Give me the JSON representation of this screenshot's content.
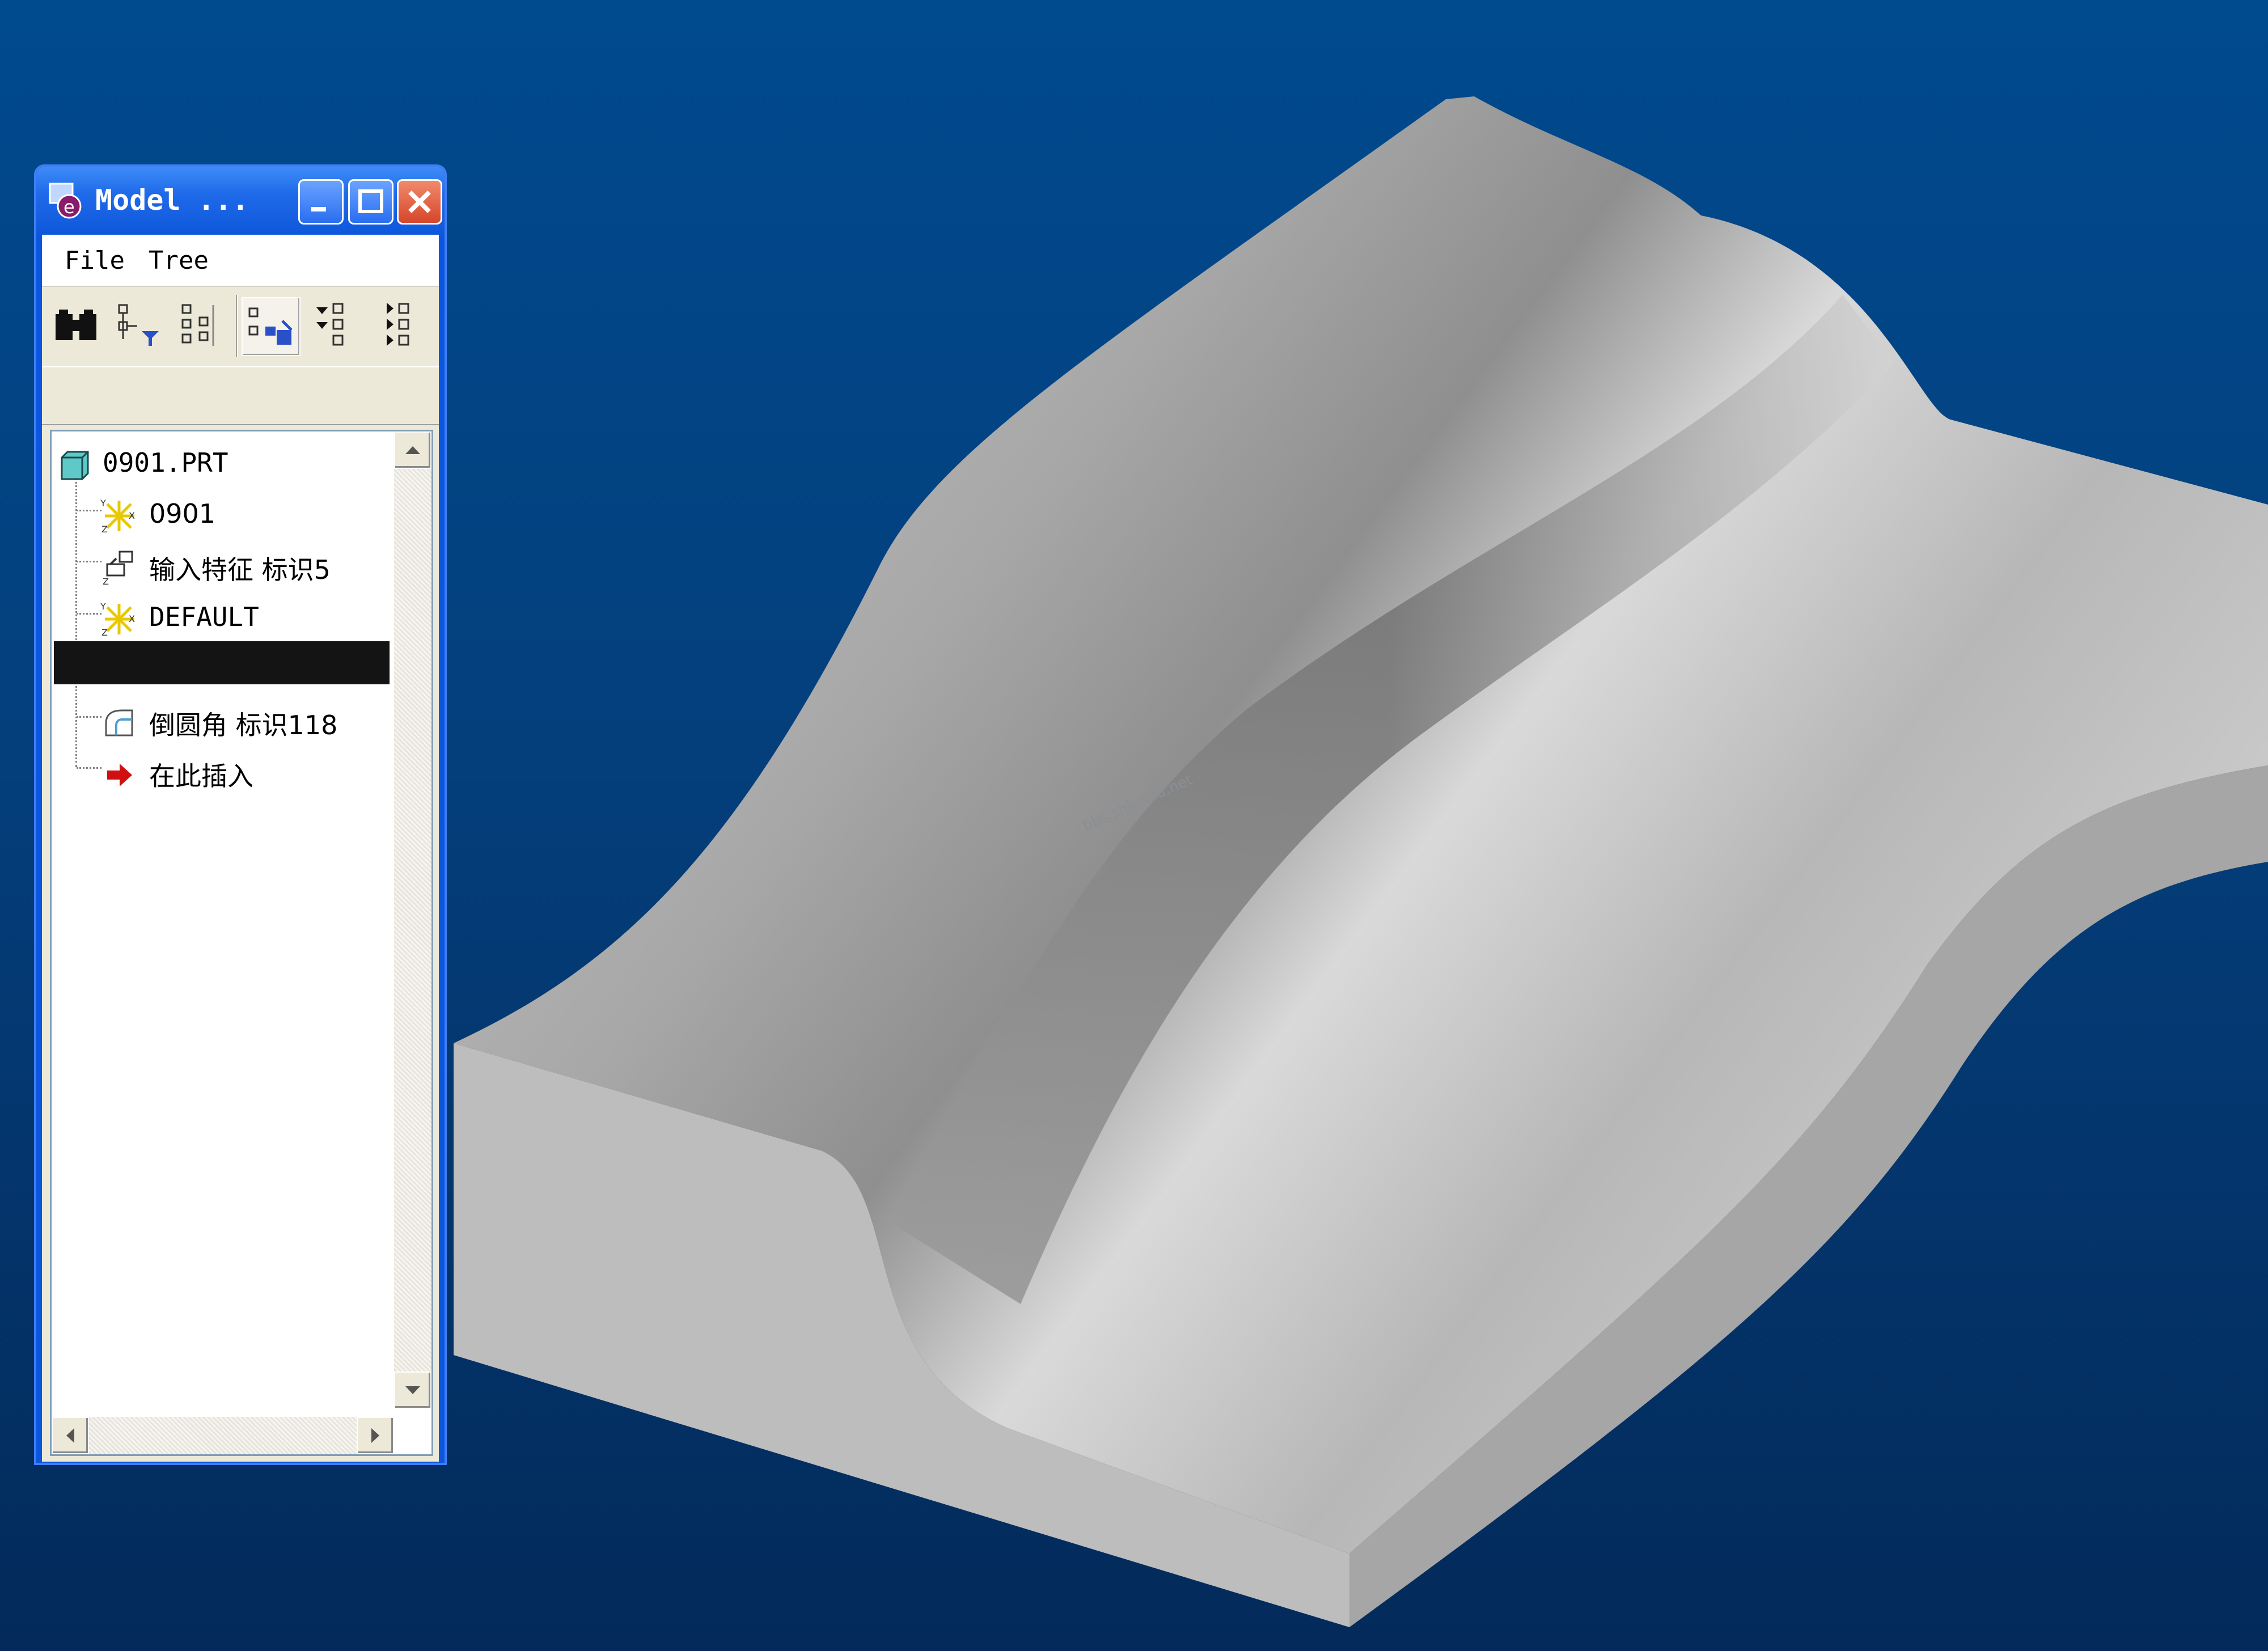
{
  "window": {
    "title": "Model ...",
    "buttons": {
      "minimize": "minimize",
      "maximize": "maximize",
      "close": "close"
    }
  },
  "menubar": {
    "file_label": "File",
    "tree_label": "Tree"
  },
  "toolbar": {
    "icons": [
      "binoculars-icon",
      "tree-filter-icon",
      "tree-columns-icon",
      "show-tree-icon",
      "collapse-all-icon",
      "expand-all-icon"
    ]
  },
  "tree": {
    "items": [
      {
        "label": "0901.PRT",
        "icon": "part-icon"
      },
      {
        "label": "0901",
        "icon": "coordinate-system-icon"
      },
      {
        "label": "输入特征 标识5",
        "icon": "import-feature-icon"
      },
      {
        "label": "DEFAULT",
        "icon": "coordinate-system-icon"
      },
      {
        "label": "",
        "icon": ""
      },
      {
        "label": "倒圆角 标识118",
        "icon": "round-feature-icon"
      },
      {
        "label": "在此插入",
        "icon": "insert-here-arrow-icon"
      }
    ]
  },
  "viewport": {
    "watermark": "bbs.shiandu.net",
    "colors": {
      "background_top": "#004a8e",
      "background_bottom": "#032a5a",
      "model_gray": "#bcbcbc"
    }
  }
}
